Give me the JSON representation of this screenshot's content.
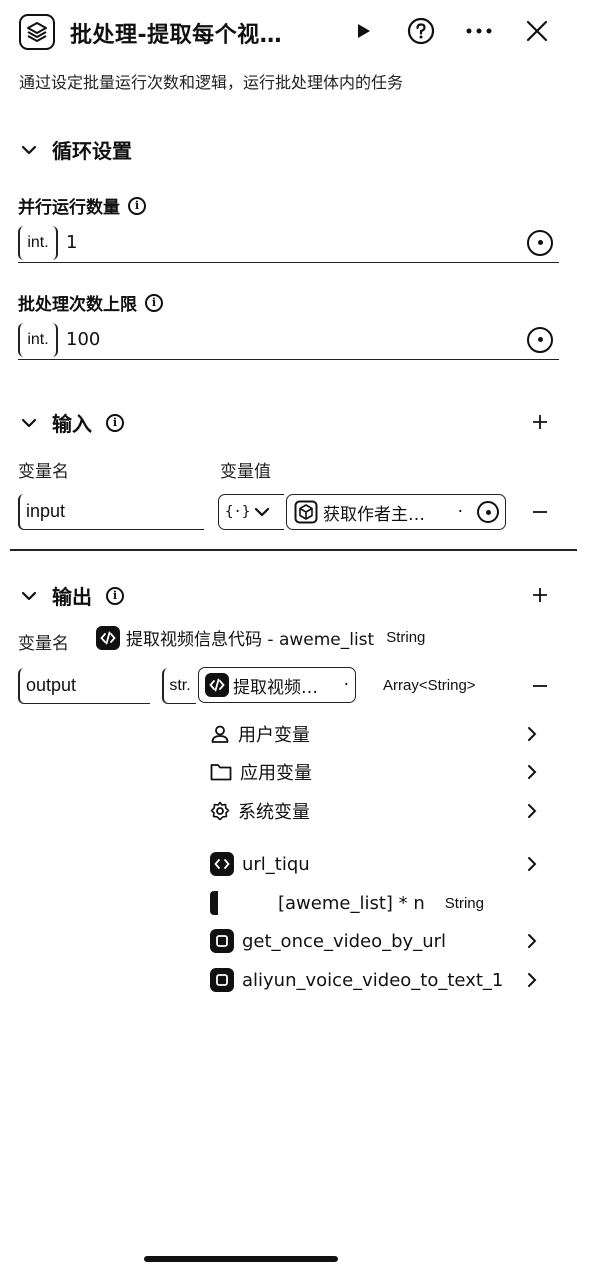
{
  "header": {
    "title": "批处理-提取每个视…",
    "description": "通过设定批量运行次数和逻辑，运行批处理体内的任务"
  },
  "loop": {
    "section_title": "循环设置",
    "parallel": {
      "label": "并行运行数量",
      "type": "int.",
      "value": "1"
    },
    "batch_limit": {
      "label": "批处理次数上限",
      "type": "int.",
      "value": "100"
    }
  },
  "input": {
    "section_title": "输入",
    "col_name": "变量名",
    "col_value": "变量值",
    "row": {
      "name": "input",
      "type_glyph": "{·}",
      "ref_label": "获取作者主…",
      "ref_dot": "·"
    }
  },
  "output": {
    "section_title": "输出",
    "col_name": "变量名",
    "hint_ref": "提取视频信息代码 - aweme_list",
    "hint_type": "String",
    "row": {
      "name": "output",
      "type": "str.",
      "ref_label": "提取视频…",
      "ref_dot": "·",
      "result_type": "Array<String>"
    }
  },
  "menu": {
    "user_vars": "用户变量",
    "app_vars": "应用变量",
    "system_vars": "系统变量",
    "nodes": [
      {
        "label": "url_tiqu",
        "has_arrow": true
      },
      {
        "label": "[aweme_list] * n",
        "type": "String"
      },
      {
        "label": "get_once_video_by_url",
        "has_arrow": true
      },
      {
        "label": "aliyun_voice_video_to_text_1",
        "has_arrow": true
      }
    ]
  }
}
